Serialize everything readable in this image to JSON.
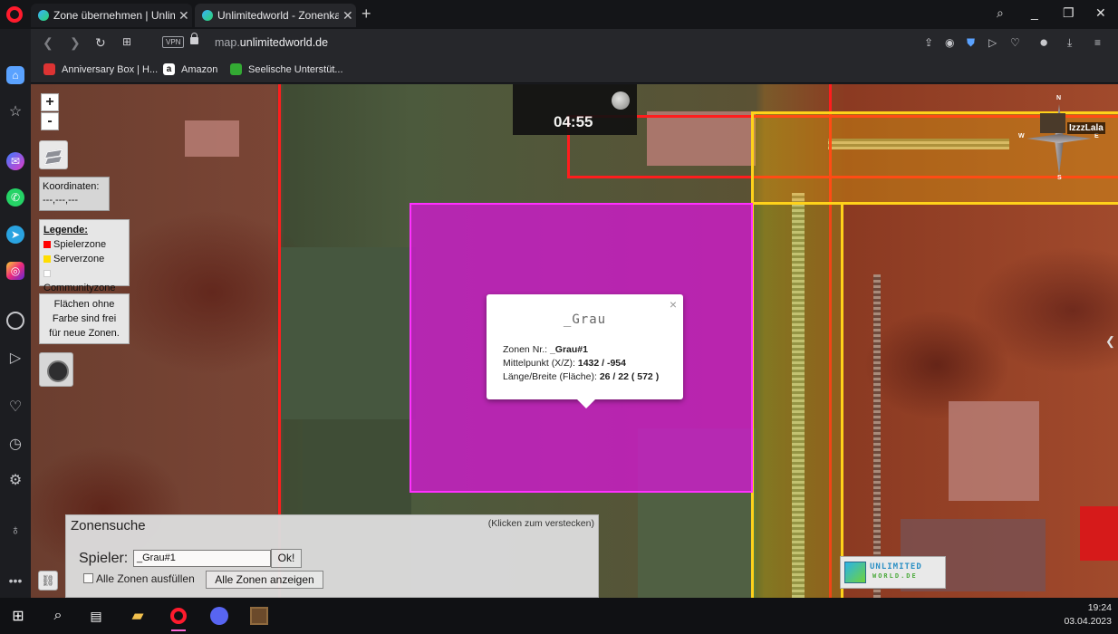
{
  "browser": {
    "tabs": [
      {
        "label": "Zone übernehmen | Unlimi",
        "active": false
      },
      {
        "label": "Unlimitedworld - Zonenkar",
        "active": true
      }
    ],
    "url_prefix": "map.",
    "url_domain": "unlimitedworld.de",
    "vpn_badge": "VPN",
    "bookmarks": [
      {
        "label": "Anniversary Box | H..."
      },
      {
        "label": "Amazon",
        "icon_text": "a"
      },
      {
        "label": "Seelische Unterstüt..."
      }
    ]
  },
  "map": {
    "zoom_in": "+",
    "zoom_out": "-",
    "coordinates_label": "Koordinaten:",
    "coordinates_value": "---,---,---",
    "legend": {
      "title": "Legende:",
      "items": [
        {
          "label": "Spielerzone",
          "color": "#ff0000"
        },
        {
          "label": "Serverzone",
          "color": "#ffdd00"
        },
        {
          "label": "Communityzone",
          "color": "#ffffff"
        }
      ]
    },
    "free_info_lines": [
      "Flächen ohne",
      "Farbe sind frei",
      "für neue Zonen."
    ],
    "clock_time": "04:55",
    "player_name": "IzzzLala",
    "compass": {
      "n": "N",
      "s": "S",
      "w": "W",
      "e": "E"
    },
    "selected_zone_color": "#e020e0"
  },
  "popup": {
    "title": "_Grau",
    "close": "×",
    "zone_nr_label": "Zonen Nr.: ",
    "zone_nr_value": "_Grau#1",
    "center_label": "Mittelpunkt (X/Z): ",
    "center_value": "1432 / -954",
    "size_label": "Länge/Breite (Fläche): ",
    "size_value": "26 / 22 ( 572 )"
  },
  "zone_search": {
    "title": "Zonensuche",
    "hide_hint": "(Klicken zum verstecken)",
    "player_label": "Spieler:",
    "player_value": "_Grau#1",
    "ok_label": "Ok!",
    "fill_all_label": "Alle Zonen ausfüllen",
    "show_all_label": "Alle Zonen anzeigen"
  },
  "logo": {
    "line1": "UNLIMITED",
    "line2": "WORLD.DE"
  },
  "taskbar": {
    "time": "19:24",
    "date": "03.04.2023"
  }
}
